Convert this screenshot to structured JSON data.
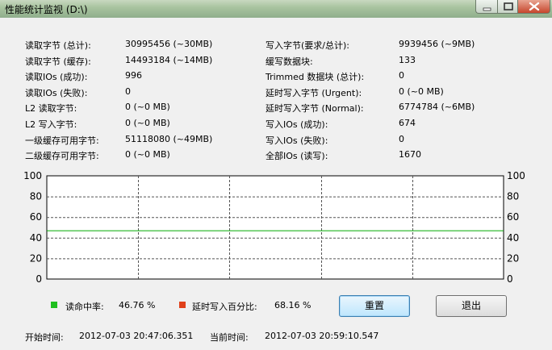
{
  "window": {
    "title": "性能统计监视 (D:\\)"
  },
  "stats_left": [
    {
      "label": "读取字节 (总计):",
      "value": "30995456 (~30MB)"
    },
    {
      "label": "读取字节 (缓存):",
      "value": "14493184 (~14MB)"
    },
    {
      "label": "读取IOs (成功):",
      "value": "996"
    },
    {
      "label": "读取IOs (失败):",
      "value": "0"
    },
    {
      "label": "L2 读取字节:",
      "value": "0 (~0 MB)"
    },
    {
      "label": "L2 写入字节:",
      "value": "0 (~0 MB)"
    },
    {
      "label": "一级缓存可用字节:",
      "value": "51118080 (~49MB)"
    },
    {
      "label": "二级缓存可用字节:",
      "value": "0 (~0 MB)"
    }
  ],
  "stats_right": [
    {
      "label": "写入字节(要求/总计):",
      "value": "9939456 (~9MB)"
    },
    {
      "label": "缓写数据块:",
      "value": "133"
    },
    {
      "label": "Trimmed 数据块 (总计):",
      "value": "0"
    },
    {
      "label": "延时写入字节 (Urgent):",
      "value": "0 (~0 MB)"
    },
    {
      "label": "延时写入字节 (Normal):",
      "value": "6774784 (~6MB)"
    },
    {
      "label": "写入IOs (成功):",
      "value": "674"
    },
    {
      "label": "写入IOs (失败):",
      "value": "0"
    },
    {
      "label": "全部IOs (读写):",
      "value": "1670"
    }
  ],
  "chart_data": {
    "type": "line",
    "ylim": [
      0,
      100
    ],
    "y_ticks": [
      "0",
      "20",
      "40",
      "60",
      "80",
      "100"
    ],
    "grid": true,
    "series": [
      {
        "name": "读命中率",
        "color": "#00aa00",
        "values": [
          46.76,
          46.76
        ]
      },
      {
        "name": "延时写入百分比",
        "color": "#e0401a",
        "values": []
      }
    ]
  },
  "legend": {
    "hit_rate_label": "读命中率:",
    "hit_rate_value": "46.76 %",
    "hit_rate_color": "#1fbf1f",
    "delayed_write_label": "延时写入百分比:",
    "delayed_write_value": "68.16 %",
    "delayed_write_color": "#e0401a"
  },
  "buttons": {
    "reset": "重置",
    "exit": "退出"
  },
  "footer": {
    "start_label": "开始时间:",
    "start_value": "2012-07-03 20:47:06.351",
    "current_label": "当前时间:",
    "current_value": "2012-07-03 20:59:10.547"
  }
}
